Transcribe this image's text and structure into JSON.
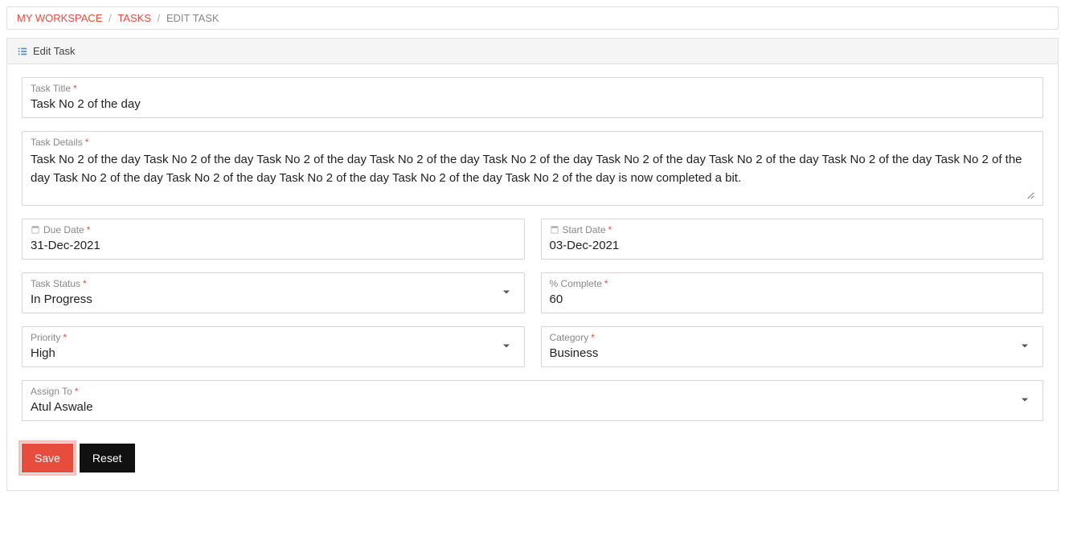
{
  "breadcrumb": {
    "item1": "MY WORKSPACE",
    "item2": "TASKS",
    "current": "EDIT TASK"
  },
  "panel": {
    "title": "Edit Task"
  },
  "fields": {
    "task_title": {
      "label": "Task Title",
      "value": "Task No 2 of the day"
    },
    "task_details": {
      "label": "Task Details",
      "value": "Task No 2 of the day Task No 2 of the day Task No 2 of the day Task No 2 of the day Task No 2 of the day Task No 2 of the day Task No 2 of the day Task No 2 of the day Task No 2 of the day Task No 2 of the day Task No 2 of the day Task No 2 of the day Task No 2 of the day Task No 2 of the day is now completed a bit."
    },
    "due_date": {
      "label": "Due Date",
      "value": "31-Dec-2021"
    },
    "start_date": {
      "label": "Start Date",
      "value": "03-Dec-2021"
    },
    "task_status": {
      "label": "Task Status",
      "value": "In Progress"
    },
    "percent_complete": {
      "label": "% Complete",
      "value": "60"
    },
    "priority": {
      "label": "Priority",
      "value": "High"
    },
    "category": {
      "label": "Category",
      "value": "Business"
    },
    "assign_to": {
      "label": "Assign To",
      "value": "Atul Aswale"
    }
  },
  "buttons": {
    "save": "Save",
    "reset": "Reset"
  }
}
